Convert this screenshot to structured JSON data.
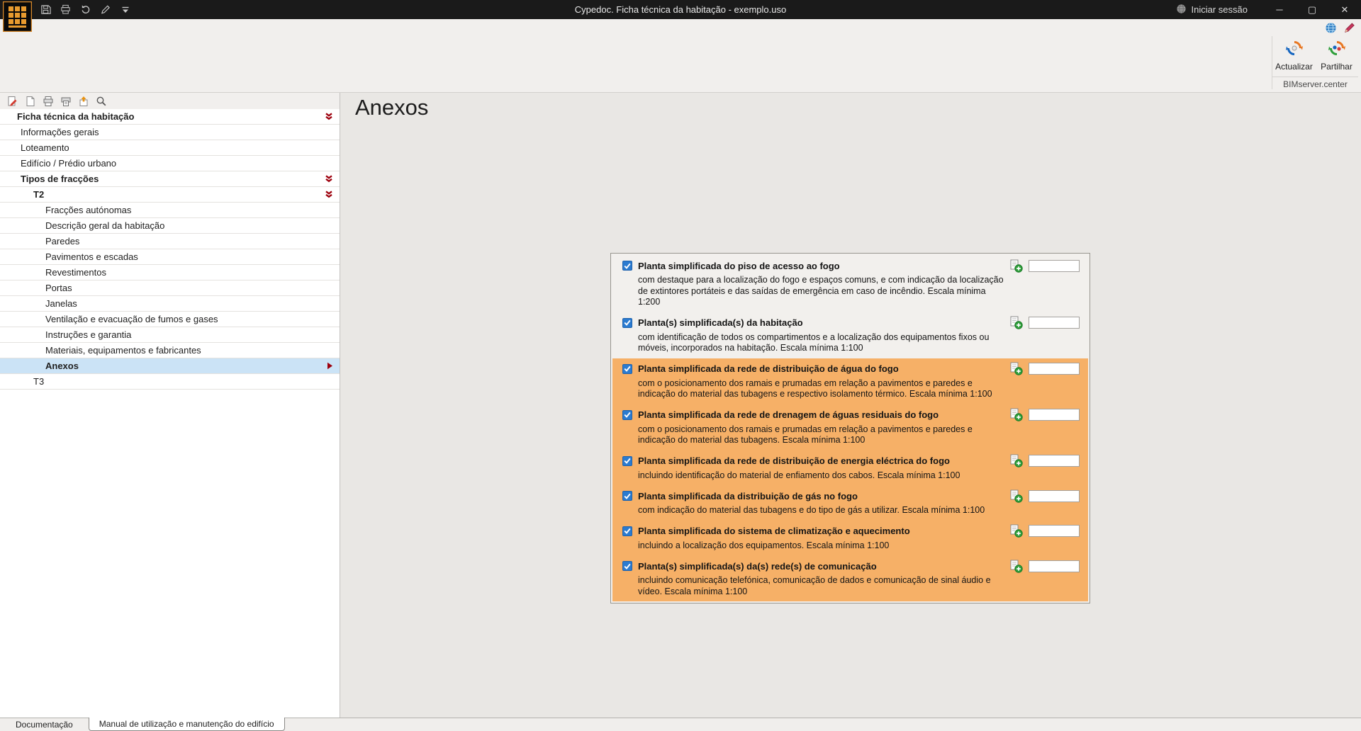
{
  "titlebar": {
    "title": "Cypedoc. Ficha técnica da habitação - exemplo.uso",
    "login_label": "Iniciar sessão"
  },
  "ribbon": {
    "update_label": "Actualizar",
    "share_label": "Partilhar",
    "group_label": "BIMserver.center"
  },
  "sidebar": {
    "tree": [
      {
        "label": "Ficha técnica da habitação",
        "level": 0,
        "bold": true,
        "arrow": "down"
      },
      {
        "label": "Informações gerais",
        "level": 1
      },
      {
        "label": "Loteamento",
        "level": 1
      },
      {
        "label": "Edifício / Prédio urbano",
        "level": 1
      },
      {
        "label": "Tipos de fracções",
        "level": 1,
        "bold": true,
        "arrow": "down"
      },
      {
        "label": "T2",
        "level": 2,
        "bold": true,
        "arrow": "down"
      },
      {
        "label": "Fracções autónomas",
        "level": 3
      },
      {
        "label": "Descrição geral da habitação",
        "level": 3
      },
      {
        "label": "Paredes",
        "level": 3
      },
      {
        "label": "Pavimentos e escadas",
        "level": 3
      },
      {
        "label": "Revestimentos",
        "level": 3
      },
      {
        "label": "Portas",
        "level": 3
      },
      {
        "label": "Janelas",
        "level": 3
      },
      {
        "label": "Ventilação e evacuação de fumos e gases",
        "level": 3
      },
      {
        "label": "Instruções e garantia",
        "level": 3
      },
      {
        "label": "Materiais, equipamentos e fabricantes",
        "level": 3
      },
      {
        "label": "Anexos",
        "level": 3,
        "bold": true,
        "selected": true,
        "arrow": "right"
      },
      {
        "label": "T3",
        "level": 2
      }
    ]
  },
  "main": {
    "title": "Anexos",
    "annexes": [
      {
        "checked": true,
        "highlight": false,
        "value": "",
        "label": "Planta simplificada do piso de acesso ao fogo",
        "desc": "com destaque para a localização do fogo e espaços comuns, e com indicação da localização de extintores portáteis e das saídas de emergência em caso de incêndio. Escala mínima 1:200"
      },
      {
        "checked": true,
        "highlight": false,
        "value": "",
        "label": "Planta(s) simplificada(s) da habitação",
        "desc": "com identificação de todos os compartimentos e a localização dos equipamentos fixos ou móveis, incorporados na habitação. Escala mínima 1:100"
      },
      {
        "checked": true,
        "highlight": true,
        "value": "",
        "label": "Planta simplificada da rede de distribuição de água do fogo",
        "desc": "com o posicionamento dos ramais e prumadas em relação a pavimentos e paredes e indicação do material das tubagens e respectivo isolamento térmico. Escala mínima 1:100"
      },
      {
        "checked": true,
        "highlight": true,
        "value": "",
        "label": "Planta simplificada da rede de drenagem de águas residuais do fogo",
        "desc": "com o posicionamento dos ramais e prumadas em relação a pavimentos e paredes e indicação do material das tubagens. Escala mínima 1:100"
      },
      {
        "checked": true,
        "highlight": true,
        "value": "",
        "label": "Planta simplificada da rede de distribuição de energia eléctrica do fogo",
        "desc": "incluindo identificação do material de enfiamento dos cabos. Escala mínima 1:100"
      },
      {
        "checked": true,
        "highlight": true,
        "value": "",
        "label": "Planta simplificada da distribuição de gás no fogo",
        "desc": "com indicação do material das tubagens e do tipo de gás a utilizar. Escala mínima 1:100"
      },
      {
        "checked": true,
        "highlight": true,
        "value": "",
        "label": "Planta simplificada do sistema de climatização e aquecimento",
        "desc": "incluindo a localização dos equipamentos. Escala mínima 1:100"
      },
      {
        "checked": true,
        "highlight": true,
        "value": "",
        "label": "Planta(s) simplificada(s) da(s) rede(s) de comunicação",
        "desc": "incluindo comunicação telefónica, comunicação de dados e comunicação de sinal áudio e vídeo. Escala mínima 1:100"
      }
    ]
  },
  "tabs": [
    {
      "label": "Documentação",
      "active": false
    },
    {
      "label": "Manual de utilização e manutenção do edifício",
      "active": true
    }
  ],
  "icons": {
    "app-icon": "orange building grid logo",
    "save-icon": "floppy disk",
    "print-icon": "printer",
    "undo-icon": "curved arrow",
    "edit-icon": "pencil",
    "toolbar-options-icon": "caret with line",
    "globe-icon": "grey globe",
    "world-icon": "blue globe",
    "pen-icon": "red marker",
    "sync-icon": "circular arrows orange/blue",
    "share-icon": "circular arrows orange/green",
    "edit-document-icon": "page with red pencil",
    "new-document-icon": "blank page",
    "print-preview-icon": "printer with page",
    "export-icon": "page with up arrow",
    "search-icon": "magnifier",
    "expand-arrow-icon": "dark red double chevron down",
    "selected-arrow-icon": "dark red triangle right",
    "add-document-icon": "page with green plus",
    "checkbox": "blue checked box"
  },
  "colors": {
    "titlebar": "#1a1a1a",
    "ribbon": "#f1efed",
    "main_bg": "#e9e7e4",
    "panel_bg": "#f2f0ed",
    "highlight_orange": "#f6b067",
    "selection_blue": "#cbe3f6",
    "check_blue": "#2b7bd0",
    "arrow_red": "#9d000d"
  }
}
